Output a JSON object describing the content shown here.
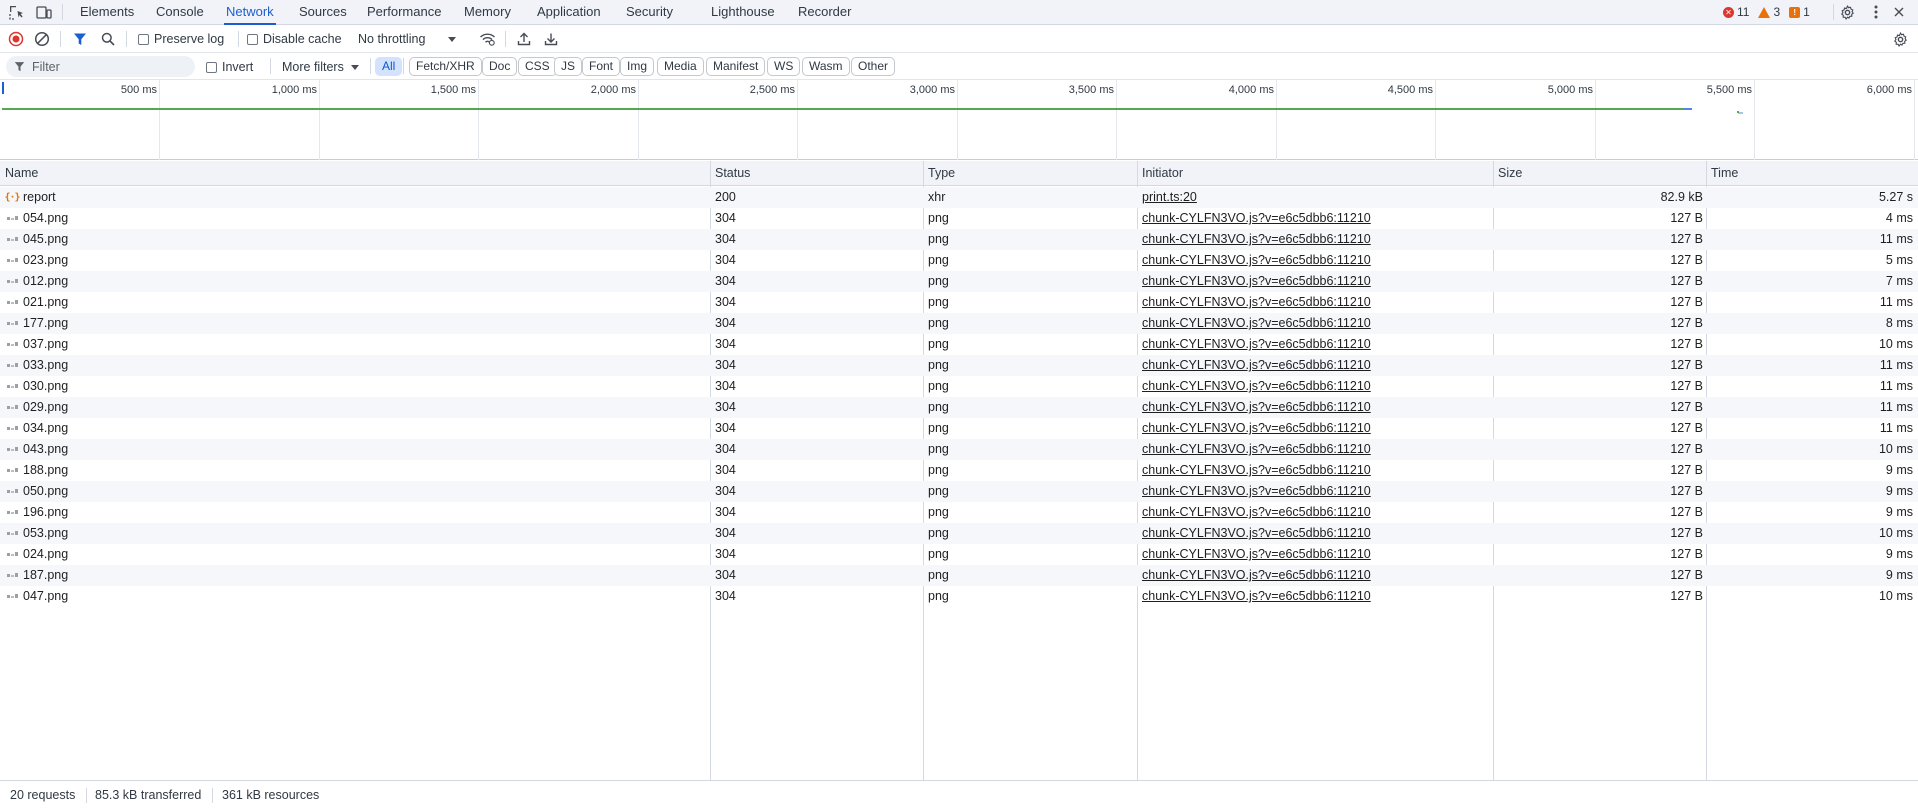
{
  "tabs": [
    {
      "label": "Elements"
    },
    {
      "label": "Console"
    },
    {
      "label": "Network"
    },
    {
      "label": "Sources"
    },
    {
      "label": "Performance"
    },
    {
      "label": "Memory"
    },
    {
      "label": "Application"
    },
    {
      "label": "Security"
    },
    {
      "label": "Lighthouse"
    },
    {
      "label": "Recorder"
    }
  ],
  "active_tab": "Network",
  "counts": {
    "errors": "11",
    "warnings": "3",
    "issues": "1"
  },
  "toolbar": {
    "preserve_log": "Preserve log",
    "disable_cache": "Disable cache",
    "throttling": "No throttling"
  },
  "filter": {
    "placeholder": "Filter",
    "invert": "Invert",
    "more_filters": "More filters",
    "chips": [
      "All",
      "Fetch/XHR",
      "Doc",
      "CSS",
      "JS",
      "Font",
      "Img",
      "Media",
      "Manifest",
      "WS",
      "Wasm",
      "Other"
    ],
    "active_chip": "All"
  },
  "overview": {
    "ticks": [
      "500 ms",
      "1,000 ms",
      "1,500 ms",
      "2,000 ms",
      "2,500 ms",
      "3,000 ms",
      "3,500 ms",
      "4,000 ms",
      "4,500 ms",
      "5,000 ms",
      "5,500 ms",
      "6,000 ms"
    ]
  },
  "columns": {
    "name": "Name",
    "status": "Status",
    "type": "Type",
    "initiator": "Initiator",
    "size": "Size",
    "time": "Time"
  },
  "requests": [
    {
      "name": "report",
      "status": "200",
      "type": "xhr",
      "initiator": "print.ts:20",
      "size": "82.9 kB",
      "time": "5.27 s",
      "icon": "xhr-icon"
    },
    {
      "name": "054.png",
      "status": "304",
      "type": "png",
      "initiator": "chunk-CYLFN3VO.js?v=e6c5dbb6:11210",
      "size": "127 B",
      "time": "4 ms",
      "icon": "image-icon"
    },
    {
      "name": "045.png",
      "status": "304",
      "type": "png",
      "initiator": "chunk-CYLFN3VO.js?v=e6c5dbb6:11210",
      "size": "127 B",
      "time": "11 ms",
      "icon": "image-icon"
    },
    {
      "name": "023.png",
      "status": "304",
      "type": "png",
      "initiator": "chunk-CYLFN3VO.js?v=e6c5dbb6:11210",
      "size": "127 B",
      "time": "5 ms",
      "icon": "image-icon"
    },
    {
      "name": "012.png",
      "status": "304",
      "type": "png",
      "initiator": "chunk-CYLFN3VO.js?v=e6c5dbb6:11210",
      "size": "127 B",
      "time": "7 ms",
      "icon": "image-icon"
    },
    {
      "name": "021.png",
      "status": "304",
      "type": "png",
      "initiator": "chunk-CYLFN3VO.js?v=e6c5dbb6:11210",
      "size": "127 B",
      "time": "11 ms",
      "icon": "image-icon"
    },
    {
      "name": "177.png",
      "status": "304",
      "type": "png",
      "initiator": "chunk-CYLFN3VO.js?v=e6c5dbb6:11210",
      "size": "127 B",
      "time": "8 ms",
      "icon": "image-icon"
    },
    {
      "name": "037.png",
      "status": "304",
      "type": "png",
      "initiator": "chunk-CYLFN3VO.js?v=e6c5dbb6:11210",
      "size": "127 B",
      "time": "10 ms",
      "icon": "image-icon"
    },
    {
      "name": "033.png",
      "status": "304",
      "type": "png",
      "initiator": "chunk-CYLFN3VO.js?v=e6c5dbb6:11210",
      "size": "127 B",
      "time": "11 ms",
      "icon": "image-icon"
    },
    {
      "name": "030.png",
      "status": "304",
      "type": "png",
      "initiator": "chunk-CYLFN3VO.js?v=e6c5dbb6:11210",
      "size": "127 B",
      "time": "11 ms",
      "icon": "image-icon"
    },
    {
      "name": "029.png",
      "status": "304",
      "type": "png",
      "initiator": "chunk-CYLFN3VO.js?v=e6c5dbb6:11210",
      "size": "127 B",
      "time": "11 ms",
      "icon": "image-icon"
    },
    {
      "name": "034.png",
      "status": "304",
      "type": "png",
      "initiator": "chunk-CYLFN3VO.js?v=e6c5dbb6:11210",
      "size": "127 B",
      "time": "11 ms",
      "icon": "image-icon"
    },
    {
      "name": "043.png",
      "status": "304",
      "type": "png",
      "initiator": "chunk-CYLFN3VO.js?v=e6c5dbb6:11210",
      "size": "127 B",
      "time": "10 ms",
      "icon": "image-icon"
    },
    {
      "name": "188.png",
      "status": "304",
      "type": "png",
      "initiator": "chunk-CYLFN3VO.js?v=e6c5dbb6:11210",
      "size": "127 B",
      "time": "9 ms",
      "icon": "image-icon"
    },
    {
      "name": "050.png",
      "status": "304",
      "type": "png",
      "initiator": "chunk-CYLFN3VO.js?v=e6c5dbb6:11210",
      "size": "127 B",
      "time": "9 ms",
      "icon": "image-icon"
    },
    {
      "name": "196.png",
      "status": "304",
      "type": "png",
      "initiator": "chunk-CYLFN3VO.js?v=e6c5dbb6:11210",
      "size": "127 B",
      "time": "9 ms",
      "icon": "image-icon"
    },
    {
      "name": "053.png",
      "status": "304",
      "type": "png",
      "initiator": "chunk-CYLFN3VO.js?v=e6c5dbb6:11210",
      "size": "127 B",
      "time": "10 ms",
      "icon": "image-icon"
    },
    {
      "name": "024.png",
      "status": "304",
      "type": "png",
      "initiator": "chunk-CYLFN3VO.js?v=e6c5dbb6:11210",
      "size": "127 B",
      "time": "9 ms",
      "icon": "image-icon"
    },
    {
      "name": "187.png",
      "status": "304",
      "type": "png",
      "initiator": "chunk-CYLFN3VO.js?v=e6c5dbb6:11210",
      "size": "127 B",
      "time": "9 ms",
      "icon": "image-icon"
    },
    {
      "name": "047.png",
      "status": "304",
      "type": "png",
      "initiator": "chunk-CYLFN3VO.js?v=e6c5dbb6:11210",
      "size": "127 B",
      "time": "10 ms",
      "icon": "image-icon"
    }
  ],
  "footer": {
    "requests": "20 requests",
    "transferred": "85.3 kB transferred",
    "resources": "361 kB resources"
  },
  "colors": {
    "accent": "#1a5fd0",
    "error": "#dc362e",
    "warning": "#e8710a",
    "waterfall": "#56a84e",
    "record": "#dc362e"
  }
}
